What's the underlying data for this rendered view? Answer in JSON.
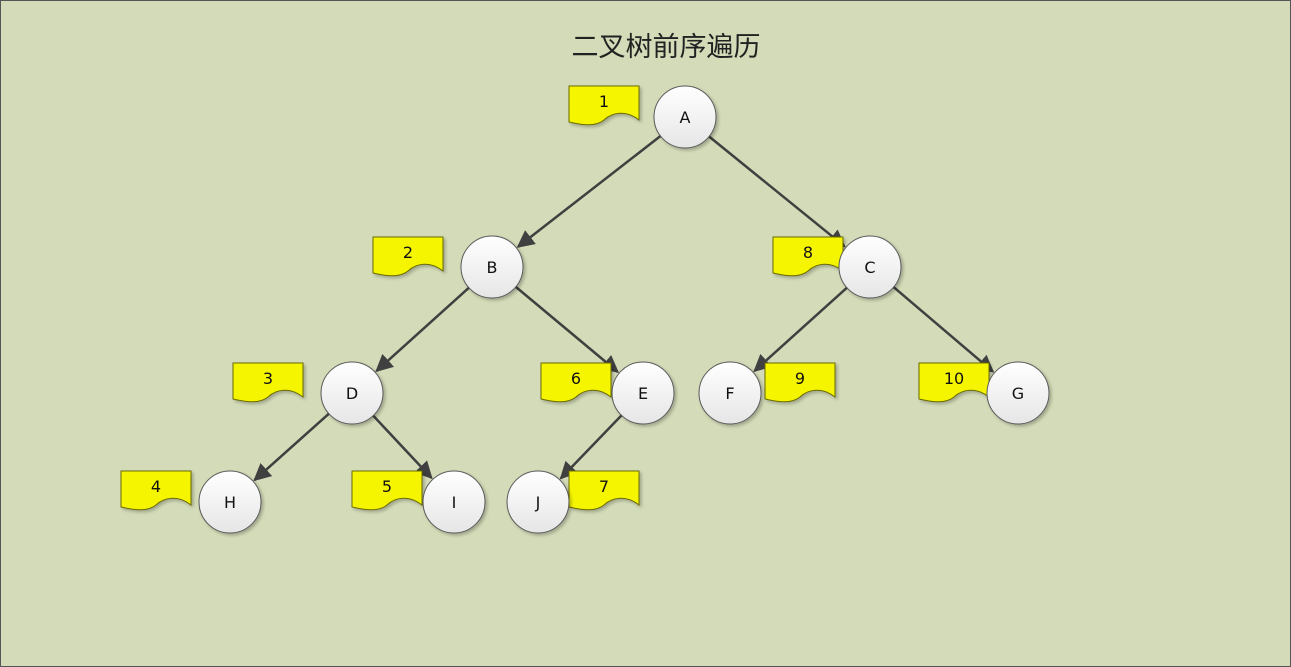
{
  "title": "二叉树前序遍历",
  "colors": {
    "background": "#d3dbb8",
    "border": "#555555",
    "node_fill_top": "#ffffff",
    "node_fill_bottom": "#e6e6e6",
    "node_stroke": "#5a5a5a",
    "edge": "#404040",
    "tag_fill": "#f5f500",
    "tag_stroke": "#6b6b00"
  },
  "nodes": [
    {
      "id": "A",
      "label": "A",
      "order": "1"
    },
    {
      "id": "B",
      "label": "B",
      "order": "2"
    },
    {
      "id": "C",
      "label": "C",
      "order": "8"
    },
    {
      "id": "D",
      "label": "D",
      "order": "3"
    },
    {
      "id": "E",
      "label": "E",
      "order": "6"
    },
    {
      "id": "F",
      "label": "F",
      "order": "9"
    },
    {
      "id": "G",
      "label": "G",
      "order": "10"
    },
    {
      "id": "H",
      "label": "H",
      "order": "4"
    },
    {
      "id": "I",
      "label": "I",
      "order": "5"
    },
    {
      "id": "J",
      "label": "J",
      "order": "7"
    }
  ],
  "edges": [
    {
      "from": "A",
      "to": "B"
    },
    {
      "from": "A",
      "to": "C"
    },
    {
      "from": "B",
      "to": "D"
    },
    {
      "from": "B",
      "to": "E"
    },
    {
      "from": "C",
      "to": "F"
    },
    {
      "from": "C",
      "to": "G"
    },
    {
      "from": "D",
      "to": "H"
    },
    {
      "from": "D",
      "to": "I"
    },
    {
      "from": "E",
      "to": "J"
    }
  ]
}
